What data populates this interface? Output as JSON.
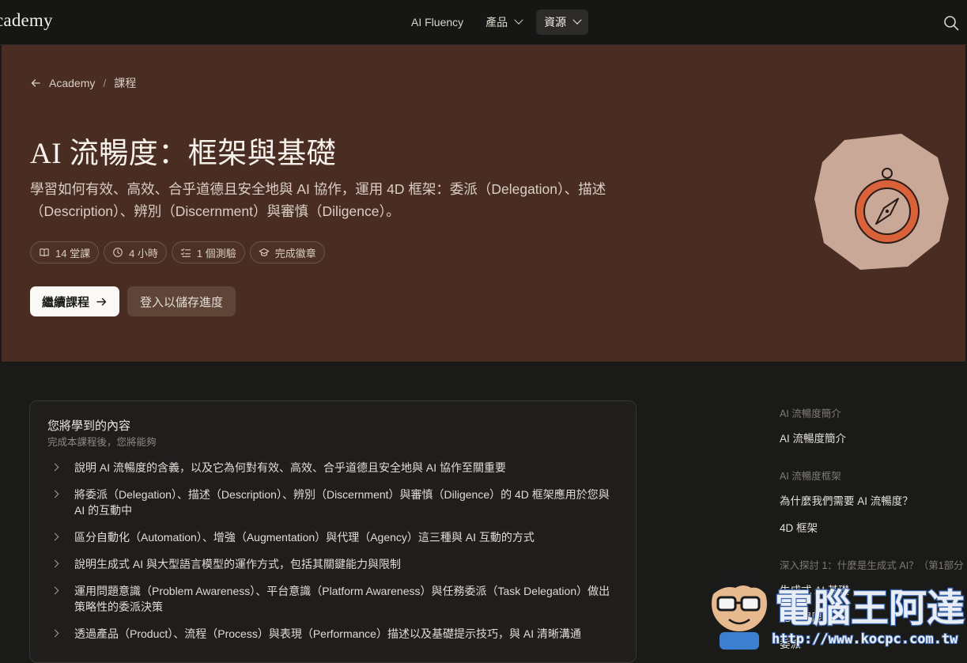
{
  "nav": {
    "brand": "cademy",
    "links": [
      {
        "label": "AI Fluency"
      },
      {
        "label": "產品"
      },
      {
        "label": "資源"
      }
    ]
  },
  "hero": {
    "breadcrumb": {
      "home": "Academy",
      "separator": "/",
      "current": "課程"
    },
    "title": "AI 流暢度：框架與基礎",
    "description": "學習如何有效、高效、合乎道德且安全地與 AI 協作，運用 4D 框架：委派（Delegation）、描述（Description）、辨別（Discernment）與審慎（Diligence）。",
    "chips": [
      "14 堂課",
      "4 小時",
      "1 個測驗",
      "完成徽章"
    ],
    "primary_button": "繼續課程",
    "secondary_button": "登入以儲存進度"
  },
  "learn": {
    "title": "您將學到的內容",
    "subtitle": "完成本課程後，您將能夠",
    "items": [
      "說明 AI 流暢度的含義，以及它為何對有效、高效、合乎道德且安全地與 AI 協作至關重要",
      "將委派（Delegation）、描述（Description）、辨別（Discernment）與審慎（Diligence）的 4D 框架應用於您與 AI 的互動中",
      "區分自動化（Automation）、增強（Augmentation）與代理（Agency）這三種與 AI 互動的方式",
      "說明生成式 AI 與大型語言模型的運作方式，包括其關鍵能力與限制",
      "運用問題意識（Problem Awareness）、平台意識（Platform Awareness）與任務委派（Task Delegation）做出策略性的委派決策",
      "透過產品（Product）、流程（Process）與表現（Performance）描述以及基礎提示技巧，與 AI 清晰溝通"
    ]
  },
  "toc": {
    "sections": [
      {
        "title": "AI 流暢度簡介",
        "items": [
          "AI 流暢度簡介"
        ]
      },
      {
        "title": "AI 流暢度框架",
        "items": [
          "為什麼我們需要 AI 流暢度？",
          "4D 框架"
        ]
      },
      {
        "title": "深入探討 1：什麼是生成式 AI？（第1部分",
        "items": [
          "生成式 AI 基礎",
          "能力與限制",
          "委派"
        ]
      }
    ]
  },
  "watermark": {
    "site": "電腦王阿達",
    "url": "http://www.kocpc.com.tw"
  },
  "colors": {
    "hero_bg": "#4a2d22",
    "page_bg": "#1a1a19",
    "accent_orange": "#d9623b",
    "art_bg": "#c9a898"
  }
}
